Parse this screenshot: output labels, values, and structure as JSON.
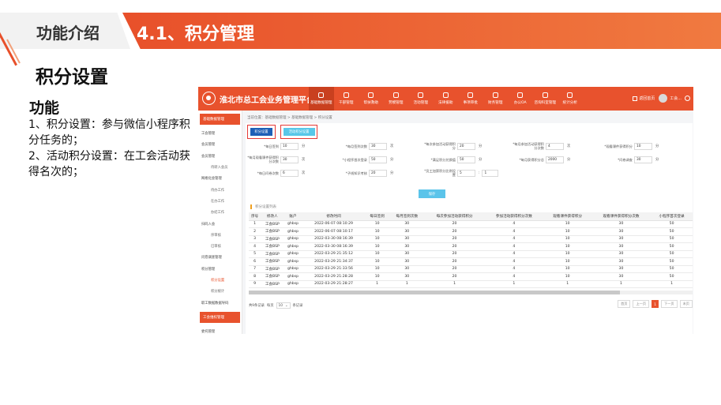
{
  "slide": {
    "section_label": "功能介绍",
    "section_title": "4.1、积分管理",
    "subtitle": "积分设置",
    "feature_title": "功能",
    "feature_lines": [
      "1、积分设置：参与微信小程序积分任务的；",
      "2、活动积分设置：在工会活动获得名次的；"
    ]
  },
  "app": {
    "title": "淮北市总工会业务管理平台",
    "nav": [
      {
        "label": "基础数据管理",
        "icon": "database-icon",
        "active": true
      },
      {
        "label": "干部管理",
        "icon": "flag-icon"
      },
      {
        "label": "帮扶救助",
        "icon": "heart-icon"
      },
      {
        "label": "劳模管理",
        "icon": "user-icon"
      },
      {
        "label": "活动管理",
        "icon": "calendar-icon"
      },
      {
        "label": "法律援助",
        "icon": "scale-icon"
      },
      {
        "label": "事项审批",
        "icon": "document-icon"
      },
      {
        "label": "财务管理",
        "icon": "lock-icon"
      },
      {
        "label": "办公OA",
        "icon": "office-icon"
      },
      {
        "label": "咨询科室管理",
        "icon": "bell-icon"
      },
      {
        "label": "统计分析",
        "icon": "chart-icon"
      }
    ],
    "topright": {
      "home": "返回首页",
      "user": "工会...",
      "user_icon": "avatar-icon"
    },
    "sidebar": {
      "head1": "基础数据管理",
      "items": [
        {
          "label": "工会管理",
          "type": "item"
        },
        {
          "label": "会员管理",
          "type": "item"
        },
        {
          "label": "会员管理",
          "type": "item"
        },
        {
          "label": "待转入会员",
          "type": "sub"
        },
        {
          "label": "网格化会管理",
          "type": "item"
        },
        {
          "label": "待办工作",
          "type": "sub"
        },
        {
          "label": "在办工作",
          "type": "sub"
        },
        {
          "label": "办结工作",
          "type": "sub"
        },
        {
          "label": "扫码入会",
          "type": "item"
        },
        {
          "label": "序审核",
          "type": "sub"
        },
        {
          "label": "已审核",
          "type": "sub"
        },
        {
          "label": "问卷调查管理",
          "type": "item"
        },
        {
          "label": "积分管理",
          "type": "item"
        },
        {
          "label": "积分设置",
          "type": "sub",
          "red": true
        },
        {
          "label": "积分统计",
          "type": "sub"
        },
        {
          "label": "职工数据数据导码",
          "type": "item"
        }
      ],
      "head2": "工会维权管理",
      "tail": "委托管理"
    },
    "breadcrumb": "当前位置：基础数据管理 > 基础数据管理 > 积分设置",
    "tabs": {
      "tab1": "积分设置",
      "tab2": "活动积分设置"
    },
    "fields": [
      {
        "label": "*每日签到",
        "value": "10",
        "unit": "分"
      },
      {
        "label": "*每月签到次数",
        "value": "30",
        "unit": "次"
      },
      {
        "label": "*每次参加活动获得积分",
        "value": "20",
        "unit": "分"
      },
      {
        "label": "*每月参加活动获得积分次数",
        "value": "4",
        "unit": "次"
      },
      {
        "label": "*观看课件获得积分",
        "value": "10",
        "unit": "分"
      },
      {
        "label": "*每月观看课件获得积分次数",
        "value": "30",
        "unit": "次"
      },
      {
        "label": "*小程序首次登录",
        "value": "50",
        "unit": "分"
      },
      {
        "label": "*满足积分兑换值",
        "value": "50",
        "unit": "分"
      },
      {
        "label": "*每月获得积分总",
        "value": "2000",
        "unit": "分"
      },
      {
        "label": "*问卷调查",
        "value": "30",
        "unit": "分"
      },
      {
        "label": "*每日问卷次数",
        "value": "6",
        "unit": "次"
      },
      {
        "label": "*子线知识考核",
        "value": "20",
        "unit": "分"
      },
      {
        "label": "*员工加第积分比例设置",
        "value": "5",
        "unit": ":",
        "value2": "1"
      }
    ],
    "save": "保存",
    "table_title": "积分设置列表",
    "columns": [
      "序号",
      "修改人",
      "账户",
      "修改时间",
      "每日签到",
      "每月签到次数",
      "每次参加活动获得积分",
      "参加活动获得积分次数",
      "观看课件获得积分",
      "观看课件获得积分次数",
      "小程序首次登录"
    ],
    "rows": [
      [
        "1",
        "工会BSP",
        "ghbsp",
        "2022-06-07 08:10:29",
        "10",
        "30",
        "20",
        "4",
        "10",
        "30",
        "50"
      ],
      [
        "2",
        "工会BSP",
        "ghbsp",
        "2022-06-07 08:10:17",
        "10",
        "30",
        "20",
        "4",
        "10",
        "30",
        "50"
      ],
      [
        "3",
        "工会BSP",
        "ghbsp",
        "2022-03-30 08:16:39",
        "10",
        "30",
        "20",
        "4",
        "10",
        "30",
        "50"
      ],
      [
        "4",
        "工会BSP",
        "ghbsp",
        "2022-03-30 08:16:39",
        "10",
        "30",
        "20",
        "4",
        "10",
        "30",
        "50"
      ],
      [
        "5",
        "工会BSP",
        "ghbsp",
        "2022-03-29 21:35:12",
        "10",
        "30",
        "20",
        "4",
        "10",
        "30",
        "50"
      ],
      [
        "6",
        "工会BSP",
        "ghbsp",
        "2022-03-29 21:34:37",
        "10",
        "30",
        "20",
        "4",
        "10",
        "30",
        "50"
      ],
      [
        "7",
        "工会BSP",
        "ghbsp",
        "2022-03-29 21:33:56",
        "10",
        "30",
        "20",
        "4",
        "10",
        "30",
        "50"
      ],
      [
        "8",
        "工会BSP",
        "ghbsp",
        "2022-03-29 21:28:28",
        "10",
        "30",
        "20",
        "4",
        "10",
        "30",
        "50"
      ],
      [
        "9",
        "工会BSP",
        "ghbsp",
        "2022-03-29 21:28:27",
        "1",
        "1",
        "1",
        "1",
        "1",
        "1",
        "1"
      ]
    ],
    "pager": {
      "total": "共9条记录",
      "per_page_label": "每页",
      "per_page": "10",
      "per_page_suffix": "条记录",
      "first": "首页",
      "prev": "上一页",
      "current": "1",
      "next": "下一页",
      "last": "末页"
    }
  }
}
